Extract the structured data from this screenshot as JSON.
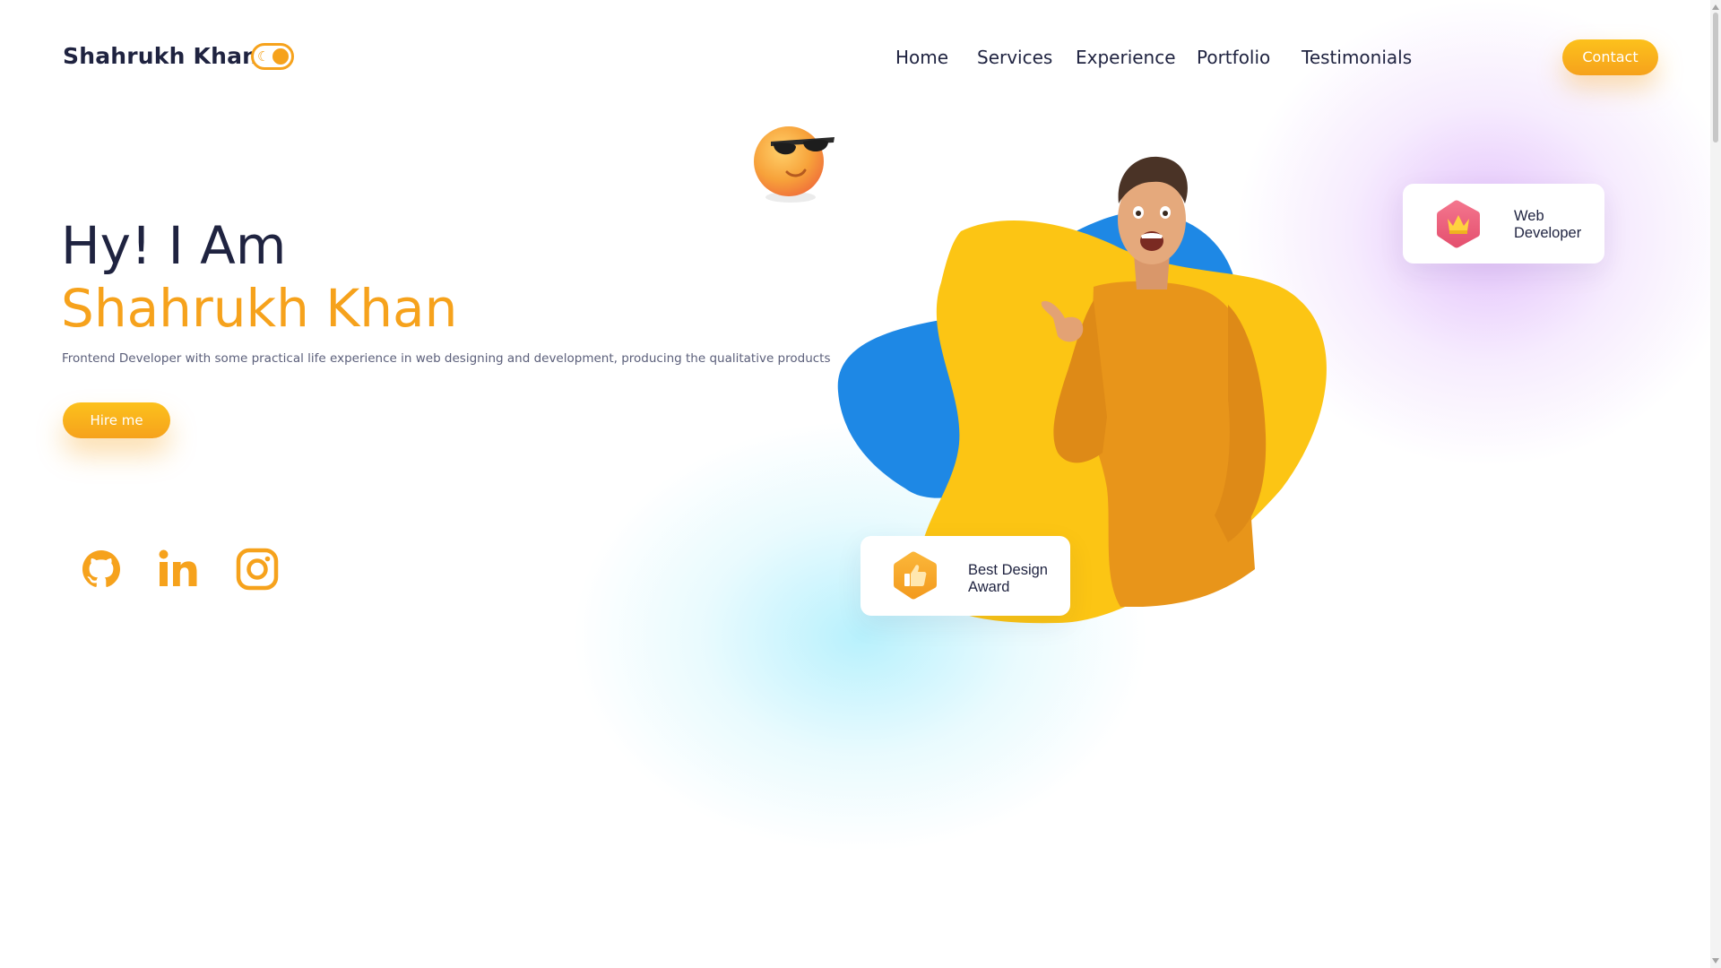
{
  "header": {
    "logo_text": "Shahrukh Khan",
    "theme_toggle_icon": "moon-icon",
    "nav": [
      "Home",
      "Services",
      "Experience",
      "Portfolio",
      "Testimonials"
    ],
    "contact_label": "Contact"
  },
  "hero": {
    "greeting": "Hy! I Am",
    "name": "Shahrukh Khan",
    "tagline": "Frontend Developer with some practical life experience in web designing and development, producing the qualitative products",
    "hire_label": "Hire me",
    "emoji": "sunglasses-emoji-icon"
  },
  "social": [
    {
      "name": "github",
      "icon": "github-icon"
    },
    {
      "name": "linkedin",
      "icon": "linkedin-icon"
    },
    {
      "name": "instagram",
      "icon": "instagram-icon"
    }
  ],
  "badges": {
    "web": {
      "line1": "Web",
      "line2": "Developer",
      "icon": "crown-icon"
    },
    "award": {
      "line1": "Best Design",
      "line2": "Award",
      "icon": "thumbs-up-icon"
    }
  },
  "colors": {
    "accent": "#f6a21c",
    "text_dark": "#1f2340",
    "blob_blue": "#1e88e5",
    "blob_yellow": "#fcc514",
    "badge_pink": "#ee5f7e"
  }
}
